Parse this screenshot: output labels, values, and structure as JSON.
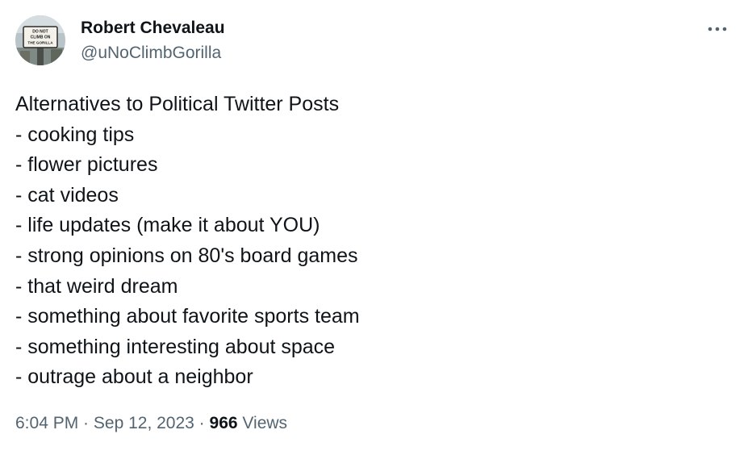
{
  "author": {
    "display_name": "Robert Chevaleau",
    "handle": "@uNoClimbGorilla",
    "avatar_sign_lines": [
      "DO NOT",
      "CLIMB ON",
      "THE GORILLA"
    ]
  },
  "more_icon": "more-horizontal-icon",
  "tweet": {
    "lines": [
      "Alternatives to Political Twitter Posts",
      "- cooking tips",
      "- flower pictures",
      "- cat videos",
      "- life updates (make it about YOU)",
      "- strong opinions on 80's board games",
      "- that weird dream",
      "- something about favorite sports team",
      "- something interesting about space",
      "- outrage about a neighbor"
    ]
  },
  "meta": {
    "time": "6:04 PM",
    "separator": " · ",
    "date": "Sep 12, 2023",
    "views_count": "966",
    "views_label": "Views"
  },
  "colors": {
    "text_primary": "#0f1419",
    "text_secondary": "#536471",
    "background": "#ffffff"
  }
}
